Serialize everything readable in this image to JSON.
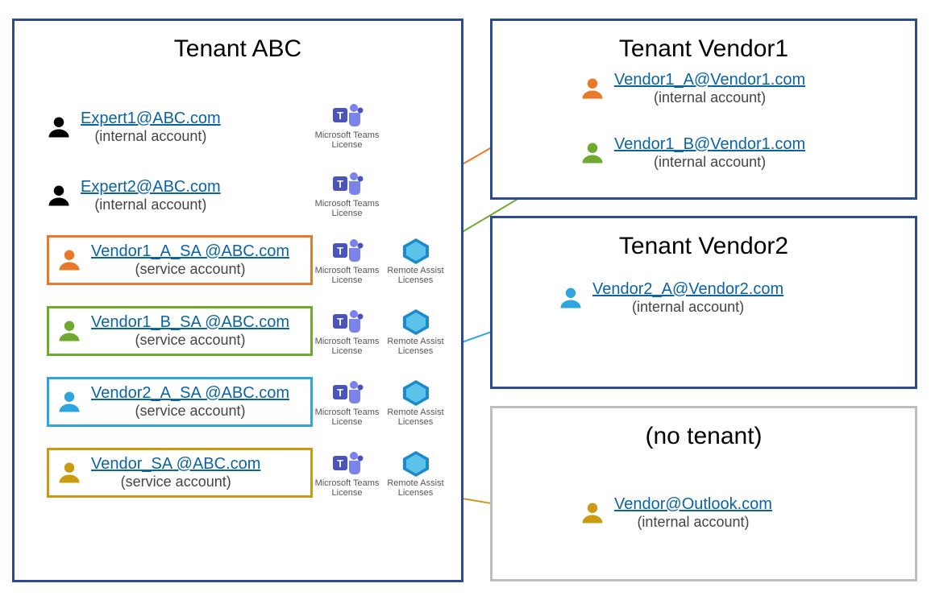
{
  "tenants": {
    "abc": {
      "title": "Tenant ABC"
    },
    "vendor1": {
      "title": "Tenant Vendor1"
    },
    "vendor2": {
      "title": "Tenant Vendor2"
    },
    "none": {
      "title": "(no tenant)"
    }
  },
  "abc_users": {
    "expert1": {
      "email": "Expert1@ABC.com",
      "sub": "(internal account)"
    },
    "expert2": {
      "email": "Expert2@ABC.com",
      "sub": "(internal account)"
    },
    "v1a": {
      "email": "Vendor1_A_SA @ABC.com",
      "sub": "(service account)",
      "color": "#E8792A"
    },
    "v1b": {
      "email": "Vendor1_B_SA @ABC.com",
      "sub": "(service account)",
      "color": "#6FA92F"
    },
    "v2a": {
      "email": "Vendor2_A_SA @ABC.com",
      "sub": "(service account)",
      "color": "#2FA5DE"
    },
    "vsa": {
      "email": "Vendor_SA @ABC.com",
      "sub": "(service account)",
      "color": "#C99A12"
    }
  },
  "ext_users": {
    "vendor1a": {
      "email": "Vendor1_A@Vendor1.com",
      "sub": "(internal account)",
      "color": "#E8792A"
    },
    "vendor1b": {
      "email": "Vendor1_B@Vendor1.com",
      "sub": "(internal account)",
      "color": "#6FA92F"
    },
    "vendor2a": {
      "email": "Vendor2_A@Vendor2.com",
      "sub": "(internal account)",
      "color": "#2FA5DE"
    },
    "outlook": {
      "email": "Vendor@Outlook.com",
      "sub": "(internal account)",
      "color": "#C99A12"
    }
  },
  "licenses": {
    "teams": "Microsoft Teams License",
    "remote": "Remote Assist Licenses"
  },
  "colors": {
    "orange": "#E8792A",
    "green": "#6FA92F",
    "blue": "#2FA5DE",
    "gold": "#C99A12",
    "navy": "#2a4b8d",
    "black": "#000000"
  }
}
